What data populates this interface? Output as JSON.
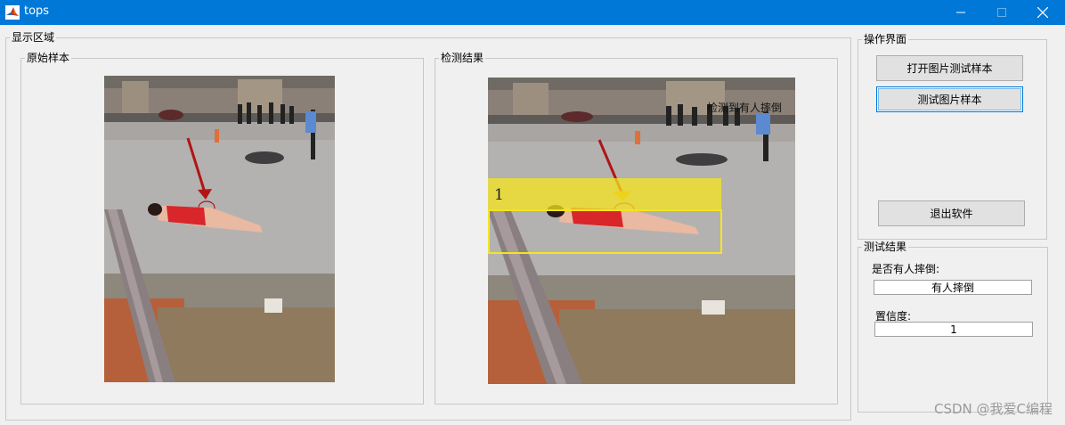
{
  "window": {
    "title": "tops",
    "accent_color": "#0078d7"
  },
  "display_area": {
    "title": "显示区域",
    "original": {
      "title": "原始样本"
    },
    "result": {
      "title": "检测结果",
      "overlay_text": "检测到有人摔倒",
      "box_label": "1",
      "box_color": "#f5e41f"
    }
  },
  "operations": {
    "title": "操作界面",
    "open_label": "打开图片测试样本",
    "test_label": "测试图片样本",
    "exit_label": "退出软件"
  },
  "test_results": {
    "title": "测试结果",
    "fall_label": "是否有人摔倒:",
    "fall_value": "有人摔倒",
    "confidence_label": "置信度:",
    "confidence_value": "1"
  },
  "watermark": "CSDN @我爱C编程"
}
